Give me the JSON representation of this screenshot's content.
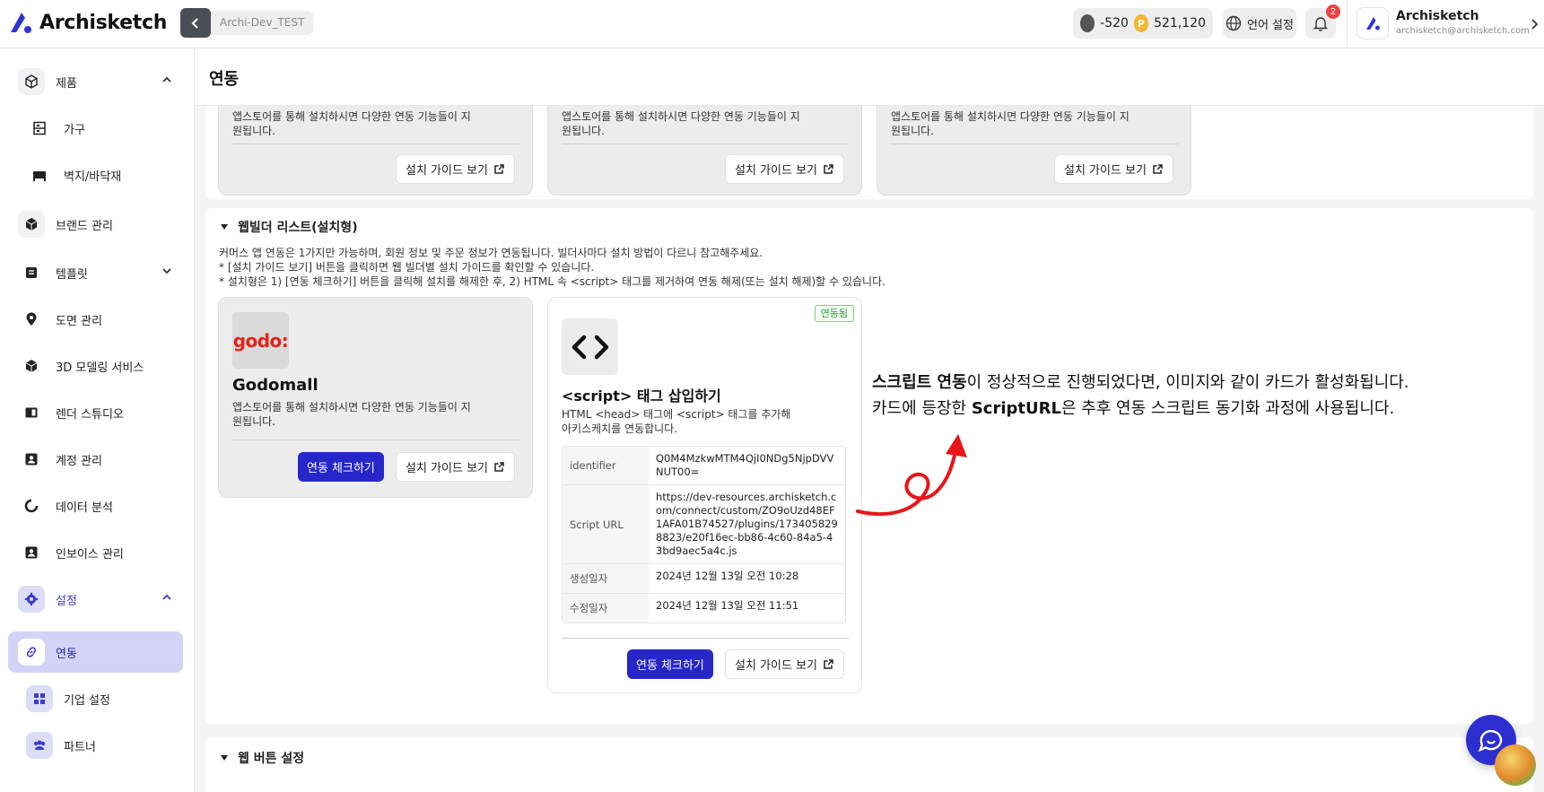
{
  "app": {
    "name": "Archisketch",
    "project": "Archi-Dev_TEST"
  },
  "header": {
    "credit_value": "-520",
    "point_value": "521,120",
    "point_icon_letter": "P",
    "language_label": "언어 설정",
    "notification_count": "2",
    "user_name": "Archisketch",
    "user_email": "archisketch@archisketch.com"
  },
  "sidebar": {
    "items": [
      {
        "label": "제품"
      },
      {
        "label": "가구"
      },
      {
        "label": "벽지/바닥재"
      },
      {
        "label": "브랜드 관리"
      },
      {
        "label": "템플릿"
      },
      {
        "label": "도면 관리"
      },
      {
        "label": "3D 모델링 서비스"
      },
      {
        "label": "렌더 스튜디오"
      },
      {
        "label": "계정 관리"
      },
      {
        "label": "데이터 분석"
      },
      {
        "label": "인보이스 관리"
      },
      {
        "label": "설정"
      },
      {
        "label": "연동"
      },
      {
        "label": "기업 설정"
      },
      {
        "label": "파트너"
      }
    ]
  },
  "page": {
    "title": "연동"
  },
  "top_cards": {
    "desc": "앱스토어를 통해 설치하시면 다양한 연동 기능들이 지원됩니다.",
    "guide_label": "설치 가이드 보기"
  },
  "webbuilder": {
    "title": "웹빌더 리스트(설치형)",
    "notice": [
      "커머스 앱 연동은 1가지만 가능하며, 회원 정보 및 주문 정보가 연동됩니다. 빌더사마다 설치 방법이 다르니 참고해주세요.",
      "* [설치 가이드 보기] 버튼을 클릭하면 웹 빌더별 설치 가이드를 확인할 수 있습니다.",
      "* 설치형은 1) [연동 체크하기] 버튼을 클릭해 설치를 해제한 후, 2) HTML 속 <script> 태그를 제거하여 연동 해제(또는 설치 해제)할 수 있습니다."
    ],
    "godomall": {
      "logo_text": "godo:",
      "name": "Godomall",
      "desc": "앱스토어를 통해 설치하시면 다양한 연동 기능들이 지원됩니다.",
      "check_label": "연동 체크하기",
      "guide_label": "설치 가이드 보기"
    },
    "script": {
      "badge": "연동됨",
      "name": "<script> 태그 삽입하기",
      "desc": "HTML <head> 태그에 <script> 태그를 추가해 아키스케치를 연동합니다.",
      "rows": [
        {
          "k": "identifier",
          "v": "Q0M4MzkwMTM4QjI0NDg5NjpDVVNUT00="
        },
        {
          "k": "Script URL",
          "v": "https://dev-resources.archisketch.com/connect/custom/ZO9oUzd48EF1AFA01B74527/plugins/1734058298823/e20f16ec-bb86-4c60-84a5-43bd9aec5a4c.js"
        },
        {
          "k": "생성일자",
          "v": "2024년 12월 13일 오전 10:28"
        },
        {
          "k": "수정일자",
          "v": "2024년 12월 13일 오전 11:51"
        }
      ],
      "check_label": "연동 체크하기",
      "guide_label": "설치 가이드 보기"
    }
  },
  "annotation": {
    "line1_bold": "스크립트 연동",
    "line1_rest": "이 정상적으로 진행되었다면, 이미지와 같이 카드가 활성화됩니다.",
    "line2_pre": "카드에 등장한 ",
    "line2_bold": "ScriptURL",
    "line2_rest": "은 추후 연동 스크립트 동기화 과정에 사용됩니다."
  },
  "webbutton": {
    "title": "웹 버튼 설정"
  },
  "colors": {
    "brand": "#2626c9",
    "accent_soft": "#d3d3f7",
    "annotation_arrow": "#e8151b"
  }
}
